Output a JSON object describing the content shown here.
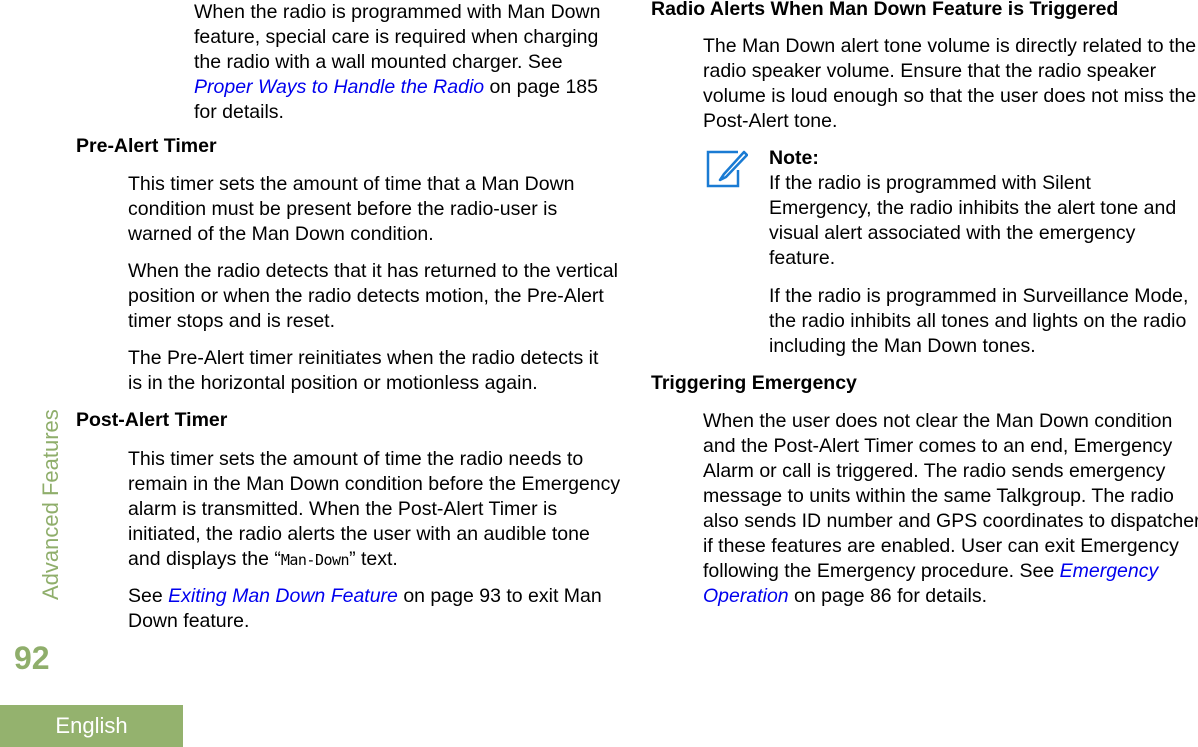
{
  "sidebar": {
    "section": "Advanced Features",
    "page_number": "92",
    "language": "English"
  },
  "left": {
    "intro": {
      "text1": "When the radio is programmed with Man Down feature, special care is required when charging the radio with a wall mounted charger. See ",
      "link": "Proper Ways to Handle the Radio",
      "text2": " on page 185 for details."
    },
    "pre_alert": {
      "heading": "Pre-Alert Timer",
      "p1": "This timer sets the amount of time that a Man Down condition must be present before the radio-user is warned of the Man Down condition.",
      "p2": "When the radio detects that it has returned to the vertical position or when the radio detects motion, the Pre-Alert timer stops and is reset.",
      "p3": "The Pre-Alert timer reinitiates when the radio detects it is in the horizontal position or motionless again."
    },
    "post_alert": {
      "heading": "Post-Alert Timer",
      "p1a": "This timer sets the amount of time the radio needs to remain in the Man Down condition before the Emergency alarm is transmitted. When the Post-Alert Timer is initiated, the radio alerts the user with an audible tone and displays the “",
      "display_text": "Man-Down",
      "p1b": "” text.",
      "p2a": "See ",
      "link": "Exiting Man Down Feature",
      "p2b": " on page 93 to exit Man Down feature."
    }
  },
  "right": {
    "alerts": {
      "heading": "Radio Alerts When Man Down Feature is Triggered",
      "p1": "The Man Down alert tone volume is directly related to the radio speaker volume. Ensure that the radio speaker volume is loud enough so that the user does not miss the Post-Alert tone.",
      "note_label": "Note:",
      "note1": "If the radio is programmed with Silent Emergency, the radio inhibits the alert tone and visual alert associated with the emergency feature.",
      "note2": "If the radio is programmed in Surveillance Mode, the radio inhibits all tones and lights on the radio including the Man Down tones."
    },
    "triggering": {
      "heading": "Triggering Emergency",
      "p1a": "When the user does not clear the Man Down condition and the Post-Alert Timer comes to an end, Emergency Alarm or call is triggered. The radio sends emergency message to units within the same Talkgroup. The radio also sends ID number and GPS coordinates to dispatcher if these features are enabled. User can exit Emergency following the Emergency procedure. See ",
      "link": "Emergency Operation",
      "p1b": " on page 86 for details."
    }
  }
}
